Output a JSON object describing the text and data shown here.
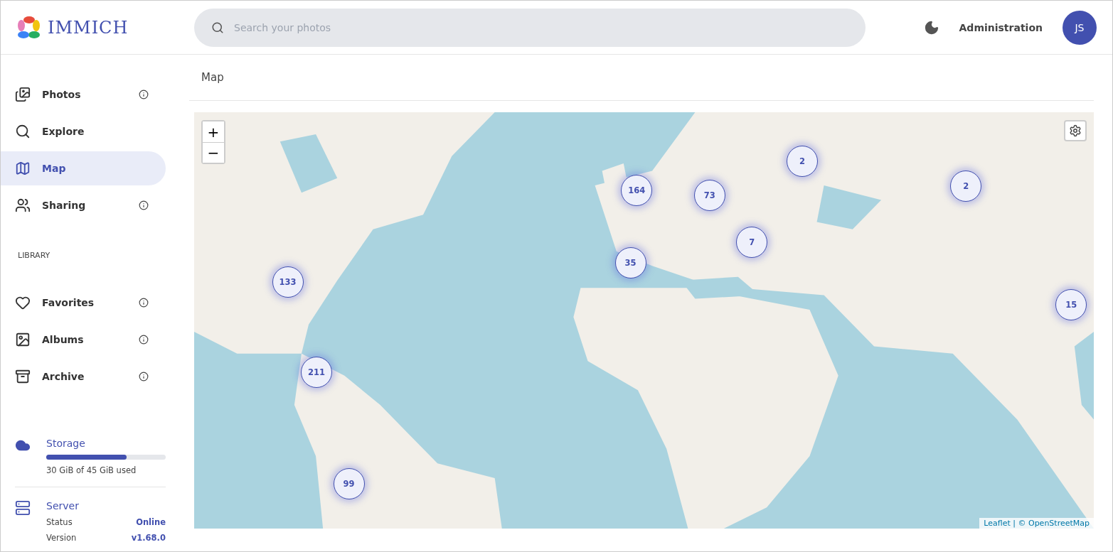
{
  "header": {
    "logo_text": "IMMICH",
    "search": {
      "placeholder": "Search your photos"
    },
    "admin_link": "Administration",
    "avatar": "JS"
  },
  "sidebar": {
    "items": [
      {
        "kind": "photos",
        "label": "Photos",
        "selected": false,
        "info": true
      },
      {
        "kind": "explore",
        "label": "Explore",
        "selected": false,
        "info": false
      },
      {
        "kind": "map",
        "label": "Map",
        "selected": true,
        "info": false
      },
      {
        "kind": "sharing",
        "label": "Sharing",
        "selected": false,
        "info": true
      }
    ],
    "library_heading": "LIBRARY",
    "library_items": [
      {
        "kind": "favorites",
        "label": "Favorites",
        "selected": false,
        "info": true
      },
      {
        "kind": "albums",
        "label": "Albums",
        "selected": false,
        "info": true
      },
      {
        "kind": "archive",
        "label": "Archive",
        "selected": false,
        "info": true
      }
    ],
    "storage": {
      "title": "Storage",
      "level": 0.67,
      "usage": "30 GiB of 45 GiB used"
    },
    "server": {
      "title": "Server",
      "rows": [
        {
          "label": "Status",
          "value": "Online"
        },
        {
          "label": "Version",
          "value": "v1.68.0"
        }
      ]
    }
  },
  "page_title": "Map",
  "map": {
    "kind": "picture",
    "zoom_in": "+",
    "zoom_out": "−",
    "attribution": "Leaflet | © OpenStreetMap",
    "clusters": [
      "164",
      "73",
      "2",
      "2",
      "7",
      "35",
      "133",
      "15",
      "211",
      "99"
    ]
  }
}
